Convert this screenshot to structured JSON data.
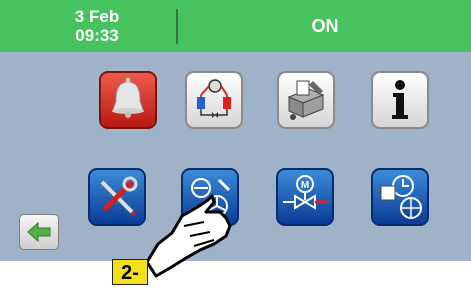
{
  "header": {
    "date": "3 Feb",
    "time": "09:33",
    "status": "ON",
    "background_color": "#46c25e"
  },
  "menu_row1": [
    {
      "icon": "alarm-bell-icon"
    },
    {
      "icon": "refrigeration-circuit-icon"
    },
    {
      "icon": "unit-configuration-icon"
    },
    {
      "icon": "info-icon"
    }
  ],
  "menu_row2": [
    {
      "icon": "service-tools-icon"
    },
    {
      "icon": "fan-compressor-settings-icon"
    },
    {
      "icon": "motorized-valve-icon"
    },
    {
      "icon": "calendar-clock-globe-icon"
    }
  ],
  "navigation": {
    "back_icon": "arrow-left-icon"
  },
  "callout": {
    "step_label": "2-",
    "pointer_icon": "pointing-hand-icon"
  }
}
